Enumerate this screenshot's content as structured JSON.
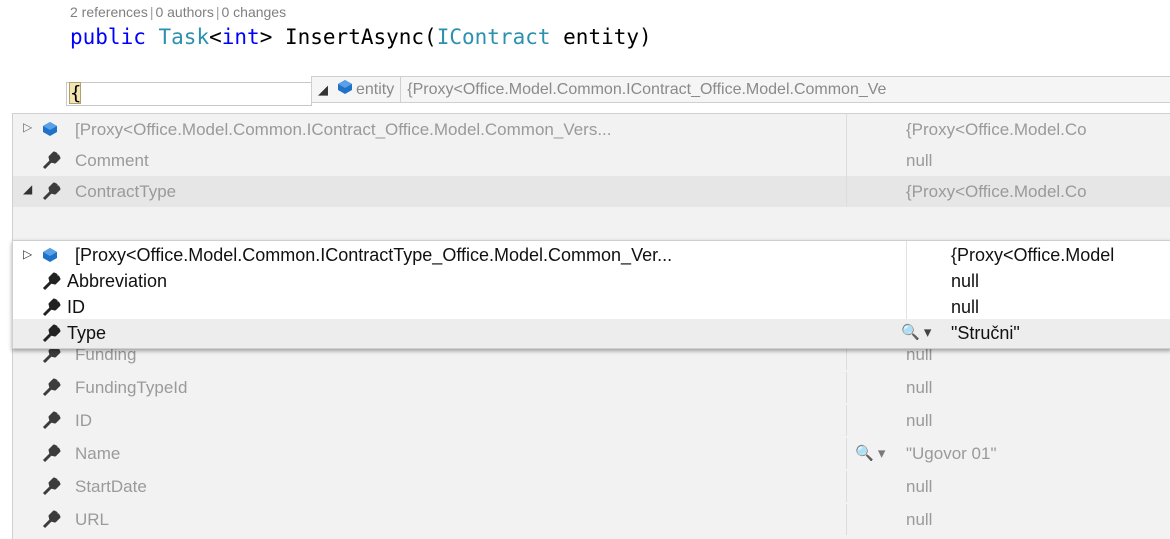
{
  "codelens": {
    "references": "2 references",
    "authors": "0 authors",
    "changes": "0 changes",
    "separator": "|"
  },
  "signature": {
    "kw_public": "public",
    "type_task": "Task",
    "generic_open": "<",
    "kw_int": "int",
    "generic_close": ">",
    "method": " InsertAsync(",
    "type_param": "IContract",
    "param": " entity)"
  },
  "brace": "{",
  "datatip_header": {
    "name": "entity",
    "value": "{Proxy<Office.Model.Common.IContract_Office.Model.Common_Ve"
  },
  "outer_rows": [
    {
      "label": "[Proxy<Office.Model.Common.IContract_Office.Model.Common_Vers...",
      "value": "{Proxy<Office.Model.Co",
      "icon": "object-icon",
      "expander": "▷"
    },
    {
      "label": "Comment",
      "value": "null",
      "icon": "property-icon"
    },
    {
      "label": "ContractType",
      "value": "{Proxy<Office.Model.Co",
      "icon": "property-icon",
      "expander": "◢"
    }
  ],
  "inner_rows": [
    {
      "label": "[Proxy<Office.Model.Common.IContractType_Office.Model.Common_Ver...",
      "value": "{Proxy<Office.Model",
      "icon": "object-icon",
      "expander": "▷"
    },
    {
      "label": "Abbreviation",
      "value": "null",
      "icon": "property-icon"
    },
    {
      "label": "ID",
      "value": "null",
      "icon": "property-icon"
    },
    {
      "label": "Type",
      "value": "\"Stručni\"",
      "icon": "property-icon",
      "magnifier": "🔍 ▾"
    }
  ],
  "lower_rows": [
    {
      "label": "Funding",
      "value": "null"
    },
    {
      "label": "FundingTypeId",
      "value": "null"
    },
    {
      "label": "ID",
      "value": "null"
    },
    {
      "label": "Name",
      "value": "\"Ugovor 01\"",
      "magnifier": "🔍 ▾"
    },
    {
      "label": "StartDate",
      "value": "null"
    },
    {
      "label": "URL",
      "value": "null"
    }
  ],
  "colors": {
    "keyword": "#0000ff",
    "type": "#2b91af",
    "property_icon": "#3c3c3c",
    "object_icon": "#1e72c8"
  }
}
